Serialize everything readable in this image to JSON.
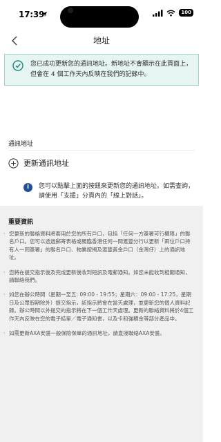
{
  "status_bar": {
    "time": "17:39",
    "battery": "100"
  },
  "nav": {
    "title": "地址"
  },
  "success_banner": {
    "text": "您已成功更新您的通訊地址。新地址不會顯示在此頁面上，但會在 4 個工作天內反映在我們的記錄中。"
  },
  "address_section": {
    "title": "通訊地址",
    "update_label": "更新通訊地址",
    "info_text": "您可以點擊上面的按鈕來更新您的通訊地址。如需查詢，請使用「支援」分頁內的「線上對話」。"
  },
  "important": {
    "title": "重要資訊",
    "items": [
      "您更新的聯絡資料將套用於您的所有戶口，包括「任何一方簽署可行權限」的聯名戶口。您可以透過郵寄表格或親臨香港任何一間滙豐分行以更新「兩位戶口持有人一同簽署」的聯名戶口、物業按揭及滙豐黃金戶口（金灣仔）上的通訊地址。",
      "您將在提交指示後及完成更新後收到短訊及電郵通知。如您未能收到相關通知，請聯絡我們。",
      "如您在辦公時間（星期一至五: 09:00 - 19:55；星期六：09:00 - 17:25，星期日及公眾假期除外）提交指示，該指示將會在當天處理，並更新您的個人資料記錄。辦公時間以外提交的指示將在下一個工作天處理。更新的聯絡資料將於4個工作天內反映在您的電子結單／電子通知書，以及卡和強積金等部分產品中。",
      "如需更新AXA安盛一般保險保單的通訊地址，請直接聯絡AXA安盛。"
    ]
  },
  "colors": {
    "success_bg": "#e6f4f2",
    "success_border": "#9dd3cc",
    "success_icon": "#1a8a7e",
    "info_icon": "#1f4e9c",
    "important_bg": "#f0f0f0"
  },
  "icons": {
    "back": "chevron-left-icon",
    "success": "check-circle-icon",
    "add": "plus-circle-icon",
    "info": "info-icon"
  }
}
